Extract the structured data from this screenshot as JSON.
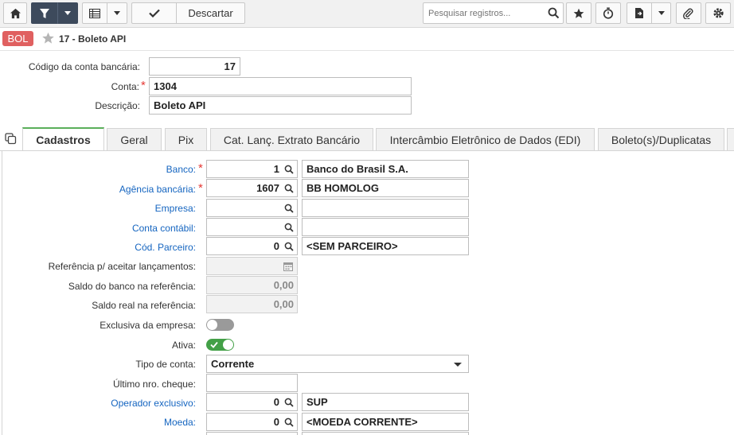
{
  "toolbar": {
    "discard_label": "Descartar",
    "search_placeholder": "Pesquisar registros..."
  },
  "header": {
    "badge": "BOL",
    "record_title": "17 - Boleto API"
  },
  "fields": {
    "codigo_label": "Código da conta bancária:",
    "codigo_value": "17",
    "conta_label": "Conta:",
    "conta_value": "1304",
    "descricao_label": "Descrição:",
    "descricao_value": "Boleto API"
  },
  "tabs": [
    "Cadastros",
    "Geral",
    "Pix",
    "Cat. Lanç. Extrato Bancário",
    "Intercâmbio Eletrônico de Dados (EDI)",
    "Boleto(s)/Duplicatas"
  ],
  "form": {
    "banco_label": "Banco:",
    "banco_code": "1",
    "banco_desc": "Banco do Brasil S.A.",
    "agencia_label": "Agência bancária:",
    "agencia_code": "1607",
    "agencia_desc": "BB HOMOLOG",
    "empresa_label": "Empresa:",
    "contabil_label": "Conta contábil:",
    "parceiro_label": "Cód. Parceiro:",
    "parceiro_code": "0",
    "parceiro_desc": "<SEM PARCEIRO>",
    "referencia_label": "Referência p/ aceitar lançamentos:",
    "saldo_banco_label": "Saldo do banco na referência:",
    "saldo_banco_value": "0,00",
    "saldo_real_label": "Saldo real na referência:",
    "saldo_real_value": "0,00",
    "exclusiva_label": "Exclusiva da empresa:",
    "exclusiva_on": false,
    "ativa_label": "Ativa:",
    "ativa_on": true,
    "tipo_label": "Tipo de conta:",
    "tipo_value": "Corrente",
    "cheque_label": "Último nro. cheque:",
    "operador_label": "Operador exclusivo:",
    "operador_code": "0",
    "operador_desc": "SUP",
    "moeda_label": "Moeda:",
    "moeda_code": "0",
    "moeda_desc": "<MOEDA CORRENTE>"
  },
  "colors": {
    "accent_tab": "#5aaf5a",
    "badge": "#e06060",
    "link_label": "#1565c0",
    "required": "#e53935",
    "toolbar_dark": "#3d4a5c"
  }
}
